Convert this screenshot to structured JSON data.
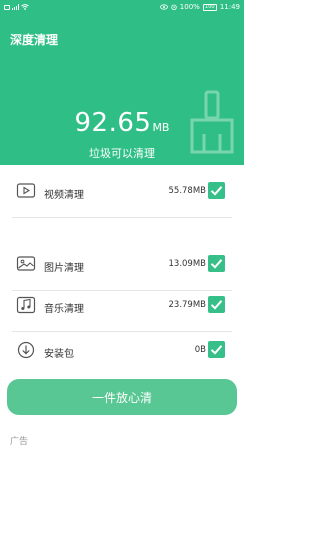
{
  "statusbar": {
    "battery_percent": "100%",
    "time": "11:49",
    "battery_text": "100"
  },
  "header": {
    "title": "深度清理",
    "size_value": "92.65",
    "size_unit": "MB",
    "subtitle": "垃圾可以清理"
  },
  "items": [
    {
      "icon": "video-icon",
      "label": "视频清理",
      "size": "55.78MB",
      "checked": true
    },
    {
      "icon": "image-icon",
      "label": "图片清理",
      "size": "13.09MB",
      "checked": true
    },
    {
      "icon": "music-icon",
      "label": "音乐清理",
      "size": "23.79MB",
      "checked": true
    },
    {
      "icon": "download-icon",
      "label": "安装包",
      "size": "0B",
      "checked": true
    }
  ],
  "clean_button": {
    "label": "一件放心清"
  },
  "ad": {
    "label": "广告"
  },
  "colors": {
    "accent": "#2fbf86",
    "button": "#58c793",
    "check": "#37bf8a"
  }
}
